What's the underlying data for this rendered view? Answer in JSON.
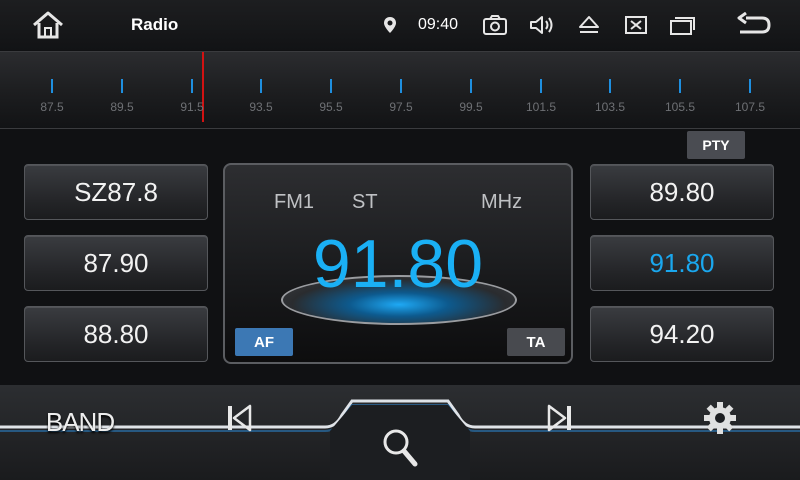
{
  "statusbar": {
    "home_icon": "home-icon",
    "title": "Radio",
    "location_icon": "location-pin-icon",
    "time": "09:40",
    "icons": [
      "camera-icon",
      "volume-icon",
      "eject-icon",
      "close-box-icon",
      "windows-icon",
      "back-icon"
    ]
  },
  "scale": {
    "labels": [
      "87.5",
      "89.5",
      "91.5",
      "93.5",
      "95.5",
      "97.5",
      "99.5",
      "101.5",
      "103.5",
      "105.5",
      "107.5"
    ],
    "current": 91.8,
    "tick_color": "#1e8fe0",
    "needle_color": "#d21212"
  },
  "pty_label": "PTY",
  "presets": {
    "left": [
      "SZ87.8",
      "87.90",
      "88.80"
    ],
    "right": [
      "89.80",
      "91.80",
      "94.20"
    ],
    "active": "91.80"
  },
  "display": {
    "band": "FM1",
    "stereo": "ST",
    "unit": "MHz",
    "frequency": "91.80",
    "af_label": "AF",
    "ta_label": "TA",
    "accent": "#1ab0f5"
  },
  "bottom": {
    "band_label": "BAND",
    "prev_icon": "skip-previous-icon",
    "search_icon": "search-icon",
    "next_icon": "skip-next-icon",
    "settings_icon": "gear-icon"
  }
}
